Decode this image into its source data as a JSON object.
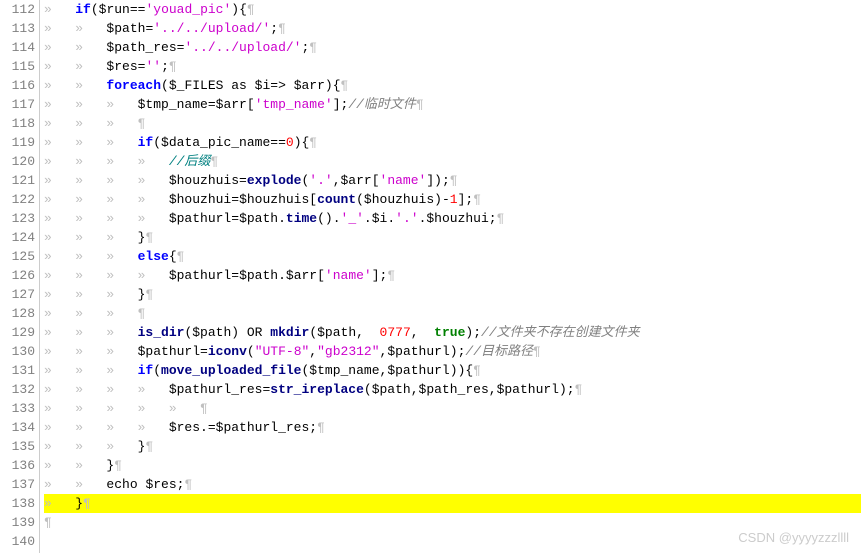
{
  "gutter": {
    "start": 112,
    "end": 140
  },
  "watermark": "CSDN @yyyyzzzllll",
  "highlight_line": 138,
  "tokens": {
    "t1": "»   ",
    "t2": "if",
    "t3": "(",
    "t4": "$run",
    "t5": "==",
    "t6": "'youad_pic'",
    "t7": "){",
    "t8": "¶",
    "t9": "»   »   ",
    "t10": "$path",
    "t11": "=",
    "t12": "'../../upload/'",
    "t13": ";",
    "t14": "$path_res",
    "t15": "$res",
    "t16": "''",
    "t17": "foreach",
    "t18": "$_FILES",
    "t19": " as ",
    "t20": "$i",
    "t21": "=>",
    "t22": " $arr",
    "t23": "»   »   »   ",
    "t24": "$tmp_name",
    "t25": "$arr",
    "t26": "[",
    "t27": "'tmp_name'",
    "t28": "]",
    "t29": "//临时文件",
    "t30": "»   »   »   ¶",
    "t31": "$data_pic_name",
    "t32": "0",
    "t33": "»   »   »   »   ",
    "t34": "//后缀",
    "t35": "$houzhuis",
    "t36": "explode",
    "t37": "'.'",
    "t38": ",",
    "t39": "'name'",
    "t40": "$houzhui",
    "t41": "count",
    "t42": "-",
    "t43": "1",
    "t44": "$pathurl",
    "t45": "time",
    "t46": "().",
    "t47": "'_'",
    "t48": ".",
    "t49": "else",
    "t50": "{",
    "t51": "}",
    "t52": "is_dir",
    "t53": " OR ",
    "t54": "mkdir",
    "t55": "0777",
    "t56": "true",
    "t57": "//文件夹不存在创建文件夹",
    "t58": "iconv",
    "t59": "\"UTF-8\"",
    "t60": "\"gb2312\"",
    "t61": "//目标路径",
    "t62": "move_uploaded_file",
    "t63": "$pathurl_res",
    "t64": "str_ireplace",
    "t65": ".=",
    "t66": "echo ",
    "t67": "¶",
    "t68": ",  ",
    "t69": ", ",
    "t70": "()",
    "t71": ")",
    "t72": "»   »   »   »   »   "
  }
}
